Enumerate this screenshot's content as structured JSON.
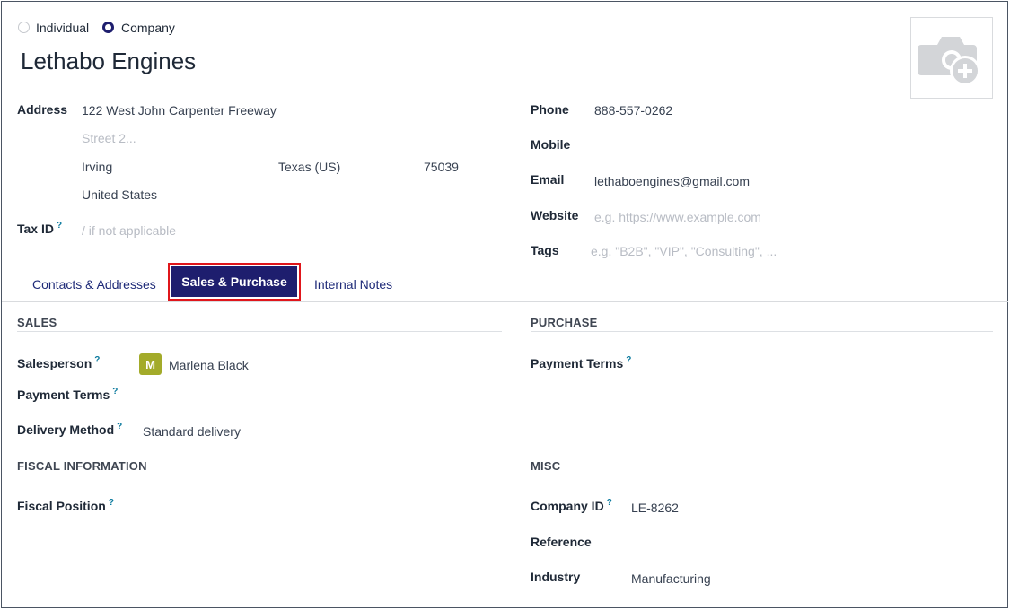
{
  "type_selector": {
    "individual": "Individual",
    "company": "Company",
    "selected": "Company"
  },
  "partner": {
    "name": "Lethabo Engines"
  },
  "address": {
    "label": "Address",
    "street": "122 West John Carpenter Freeway",
    "street2_placeholder": "Street 2...",
    "city": "Irving",
    "state": "Texas (US)",
    "zip": "75039",
    "country": "United States"
  },
  "tax": {
    "label": "Tax ID",
    "help": "?",
    "placeholder": "/ if not applicable"
  },
  "contact": {
    "phone_label": "Phone",
    "phone": "888-557-0262",
    "mobile_label": "Mobile",
    "mobile": "",
    "email_label": "Email",
    "email": "lethaboengines@gmail.com",
    "website_label": "Website",
    "website_placeholder": "e.g. https://www.example.com",
    "tags_label": "Tags",
    "tags_placeholder": "e.g. \"B2B\", \"VIP\", \"Consulting\", ..."
  },
  "tabs": [
    {
      "label": "Contacts & Addresses",
      "active": false
    },
    {
      "label": "Sales & Purchase",
      "active": true
    },
    {
      "label": "Internal Notes",
      "active": false
    }
  ],
  "sales": {
    "title": "SALES",
    "salesperson_label": "Salesperson",
    "salesperson_initial": "M",
    "salesperson": "Marlena Black",
    "payment_terms_label": "Payment Terms",
    "delivery_label": "Delivery Method",
    "delivery": "Standard delivery",
    "help": "?"
  },
  "purchase": {
    "title": "PURCHASE",
    "payment_terms_label": "Payment Terms",
    "help": "?"
  },
  "fiscal": {
    "title": "FISCAL INFORMATION",
    "position_label": "Fiscal Position",
    "help": "?"
  },
  "misc": {
    "title": "MISC",
    "company_id_label": "Company ID",
    "company_id": "LE-8262",
    "reference_label": "Reference",
    "industry_label": "Industry",
    "industry": "Manufacturing",
    "help": "?"
  },
  "colors": {
    "accent": "#1e1e6e",
    "highlight": "#e0161b",
    "avatar_bg": "#a3ab2a",
    "link": "#1e2a78"
  },
  "icons": {
    "image_upload": "camera-plus-icon"
  }
}
